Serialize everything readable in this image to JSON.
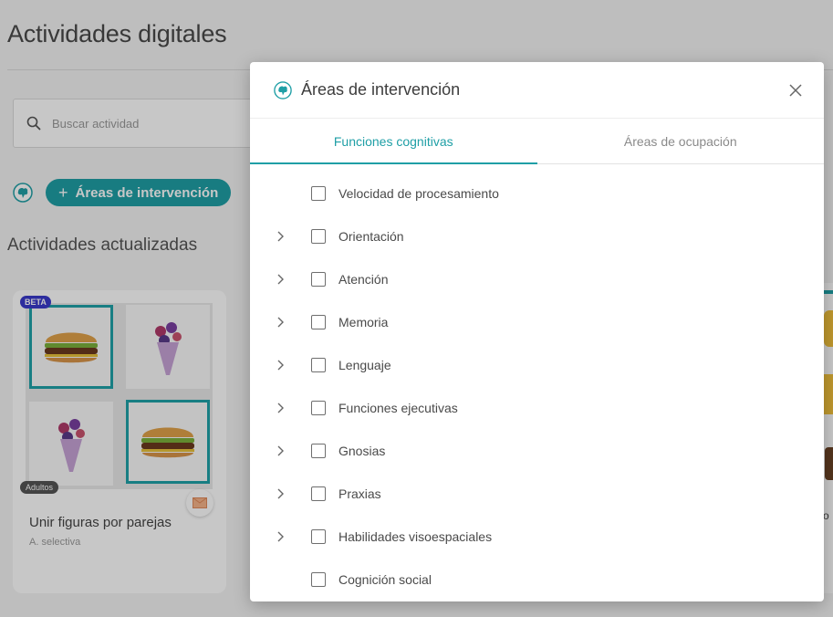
{
  "page": {
    "title": "Actividades digitales",
    "search_placeholder": "Buscar actividad",
    "areas_button": "Áreas de intervención",
    "section_title": "Actividades actualizadas",
    "card": {
      "beta_badge": "BETA",
      "audience_badge": "Adultos",
      "title": "Unir figuras por parejas",
      "subtitle": "A. selectiva"
    },
    "peek_text": "o"
  },
  "modal": {
    "title": "Áreas de intervención",
    "tabs": [
      {
        "label": "Funciones cognitivas",
        "active": true
      },
      {
        "label": "Áreas de ocupación",
        "active": false
      }
    ],
    "items": [
      {
        "label": "Velocidad de procesamiento",
        "expandable": false,
        "checked": false
      },
      {
        "label": "Orientación",
        "expandable": true,
        "checked": false
      },
      {
        "label": "Atención",
        "expandable": true,
        "checked": false
      },
      {
        "label": "Memoria",
        "expandable": true,
        "checked": false
      },
      {
        "label": "Lenguaje",
        "expandable": true,
        "checked": false
      },
      {
        "label": "Funciones ejecutivas",
        "expandable": true,
        "checked": false
      },
      {
        "label": "Gnosias",
        "expandable": true,
        "checked": false
      },
      {
        "label": "Praxias",
        "expandable": true,
        "checked": false
      },
      {
        "label": "Habilidades visoespaciales",
        "expandable": true,
        "checked": false
      },
      {
        "label": "Cognición social",
        "expandable": false,
        "checked": false
      }
    ]
  },
  "colors": {
    "accent": "#1f9fa6",
    "beta": "#3a3acb"
  },
  "icons": [
    "search-icon",
    "brain-icon",
    "close-icon",
    "chevron-right-icon",
    "mail-icon",
    "burger-icon",
    "flower-bouquet-icon"
  ]
}
